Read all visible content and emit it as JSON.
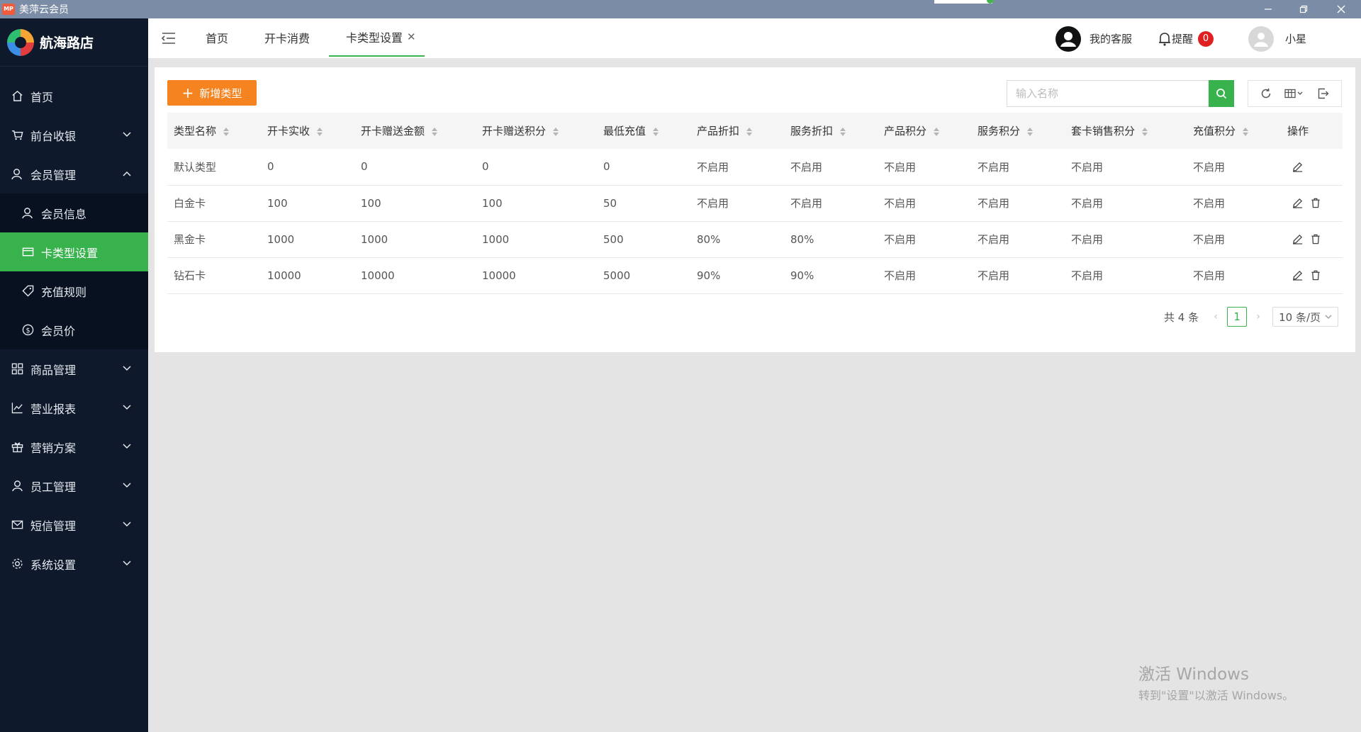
{
  "window": {
    "title": "美萍云会员",
    "icon_text": "MP"
  },
  "sidebar": {
    "brand": "航海路店",
    "items": [
      {
        "label": "首页",
        "icon": "home-icon"
      },
      {
        "label": "前台收银",
        "icon": "cart-icon"
      },
      {
        "label": "会员管理",
        "icon": "member-icon"
      },
      {
        "label": "商品管理",
        "icon": "grid-icon"
      },
      {
        "label": "营业报表",
        "icon": "chart-icon"
      },
      {
        "label": "营销方案",
        "icon": "gift-icon"
      },
      {
        "label": "员工管理",
        "icon": "user-icon"
      },
      {
        "label": "短信管理",
        "icon": "mail-icon"
      },
      {
        "label": "系统设置",
        "icon": "gear-icon"
      }
    ],
    "submenu": [
      {
        "label": "会员信息",
        "icon": "member-info-icon"
      },
      {
        "label": "卡类型设置",
        "icon": "card-icon"
      },
      {
        "label": "充值规则",
        "icon": "tag-icon"
      },
      {
        "label": "会员价",
        "icon": "dollar-icon"
      }
    ]
  },
  "header": {
    "tabs": [
      "首页",
      "开卡消费",
      "卡类型设置"
    ],
    "service": "我的客服",
    "remind": "提醒",
    "remind_count": "0",
    "user": "小星"
  },
  "toolbar": {
    "add_label": "新增类型",
    "search_placeholder": "输入名称"
  },
  "table": {
    "columns": [
      "类型名称",
      "开卡实收",
      "开卡赠送金额",
      "开卡赠送积分",
      "最低充值",
      "产品折扣",
      "服务折扣",
      "产品积分",
      "服务积分",
      "套卡销售积分",
      "充值积分",
      "操作"
    ],
    "rows": [
      [
        "默认类型",
        "0",
        "0",
        "0",
        "0",
        "不启用",
        "不启用",
        "不启用",
        "不启用",
        "不启用",
        "不启用"
      ],
      [
        "白金卡",
        "100",
        "100",
        "100",
        "50",
        "不启用",
        "不启用",
        "不启用",
        "不启用",
        "不启用",
        "不启用"
      ],
      [
        "黑金卡",
        "1000",
        "1000",
        "1000",
        "500",
        "80%",
        "80%",
        "不启用",
        "不启用",
        "不启用",
        "不启用"
      ],
      [
        "钻石卡",
        "10000",
        "10000",
        "10000",
        "5000",
        "90%",
        "90%",
        "不启用",
        "不启用",
        "不启用",
        "不启用"
      ]
    ]
  },
  "pagination": {
    "total_text": "共 4 条",
    "current_page": "1",
    "page_size": "10 条/页"
  },
  "watermark": {
    "line1": "激活 Windows",
    "line2": "转到\"设置\"以激活 Windows。"
  },
  "colors": {
    "sidebar_bg": "#0e1a2c",
    "accent_green": "#37b24d",
    "add_orange": "#f5831f",
    "badge_red": "#e02020"
  }
}
